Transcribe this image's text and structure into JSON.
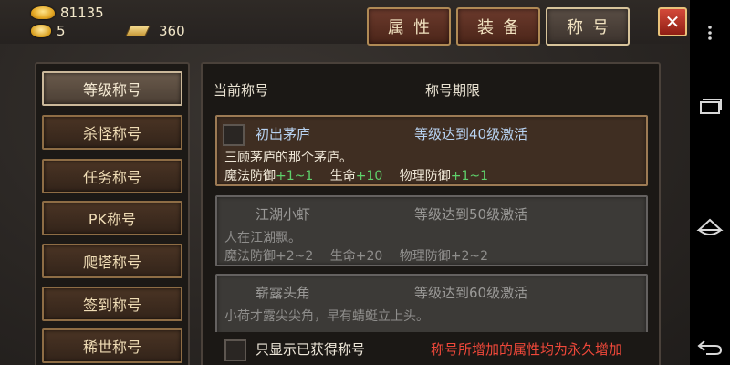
{
  "resources": {
    "gold": "81135",
    "ingots": "5",
    "tickets": "360"
  },
  "tabs": [
    {
      "label": "属性",
      "active": false
    },
    {
      "label": "装备",
      "active": false
    },
    {
      "label": "称号",
      "active": true
    }
  ],
  "close_label": "✕",
  "sidebar": {
    "items": [
      {
        "label": "等级称号",
        "active": true
      },
      {
        "label": "杀怪称号",
        "active": false
      },
      {
        "label": "任务称号",
        "active": false
      },
      {
        "label": "PK称号",
        "active": false
      },
      {
        "label": "爬塔称号",
        "active": false
      },
      {
        "label": "签到称号",
        "active": false
      },
      {
        "label": "稀世称号",
        "active": false
      }
    ]
  },
  "panel": {
    "header_current": "当前称号",
    "header_period": "称号期限",
    "titles": [
      {
        "name": "初出茅庐",
        "condition": "等级达到40级激活",
        "description": "三顾茅庐的那个茅庐。",
        "stats": [
          {
            "label": "魔法防御",
            "value": "+1~1"
          },
          {
            "label": "生命",
            "value": "+10"
          },
          {
            "label": "物理防御",
            "value": "+1~1"
          }
        ]
      },
      {
        "name": "江湖小虾",
        "condition": "等级达到50级激活",
        "description": "人在江湖飘。",
        "stats": [
          {
            "label": "魔法防御",
            "value": "+2~2"
          },
          {
            "label": "生命",
            "value": "+20"
          },
          {
            "label": "物理防御",
            "value": "+2~2"
          }
        ]
      },
      {
        "name": "崭露头角",
        "condition": "等级达到60级激活",
        "description": "小荷才露尖尖角，早有蜻蜓立上头。",
        "stats": []
      }
    ],
    "show_owned_label": "只显示已获得称号",
    "permanent_note": "称号所增加的属性均为永久增加"
  },
  "colors": {
    "accent_text": "#b8d3f2",
    "stat_bonus": "#5fd16b",
    "warning_text": "#f0483a"
  },
  "icons": {
    "gold": "gold-ingot-icon",
    "ingots": "gold-pile-icon",
    "tickets": "ticket-icon",
    "nav_menu": "more-vert-icon",
    "nav_recent": "recent-apps-icon",
    "nav_home": "home-icon",
    "nav_back": "back-icon"
  }
}
